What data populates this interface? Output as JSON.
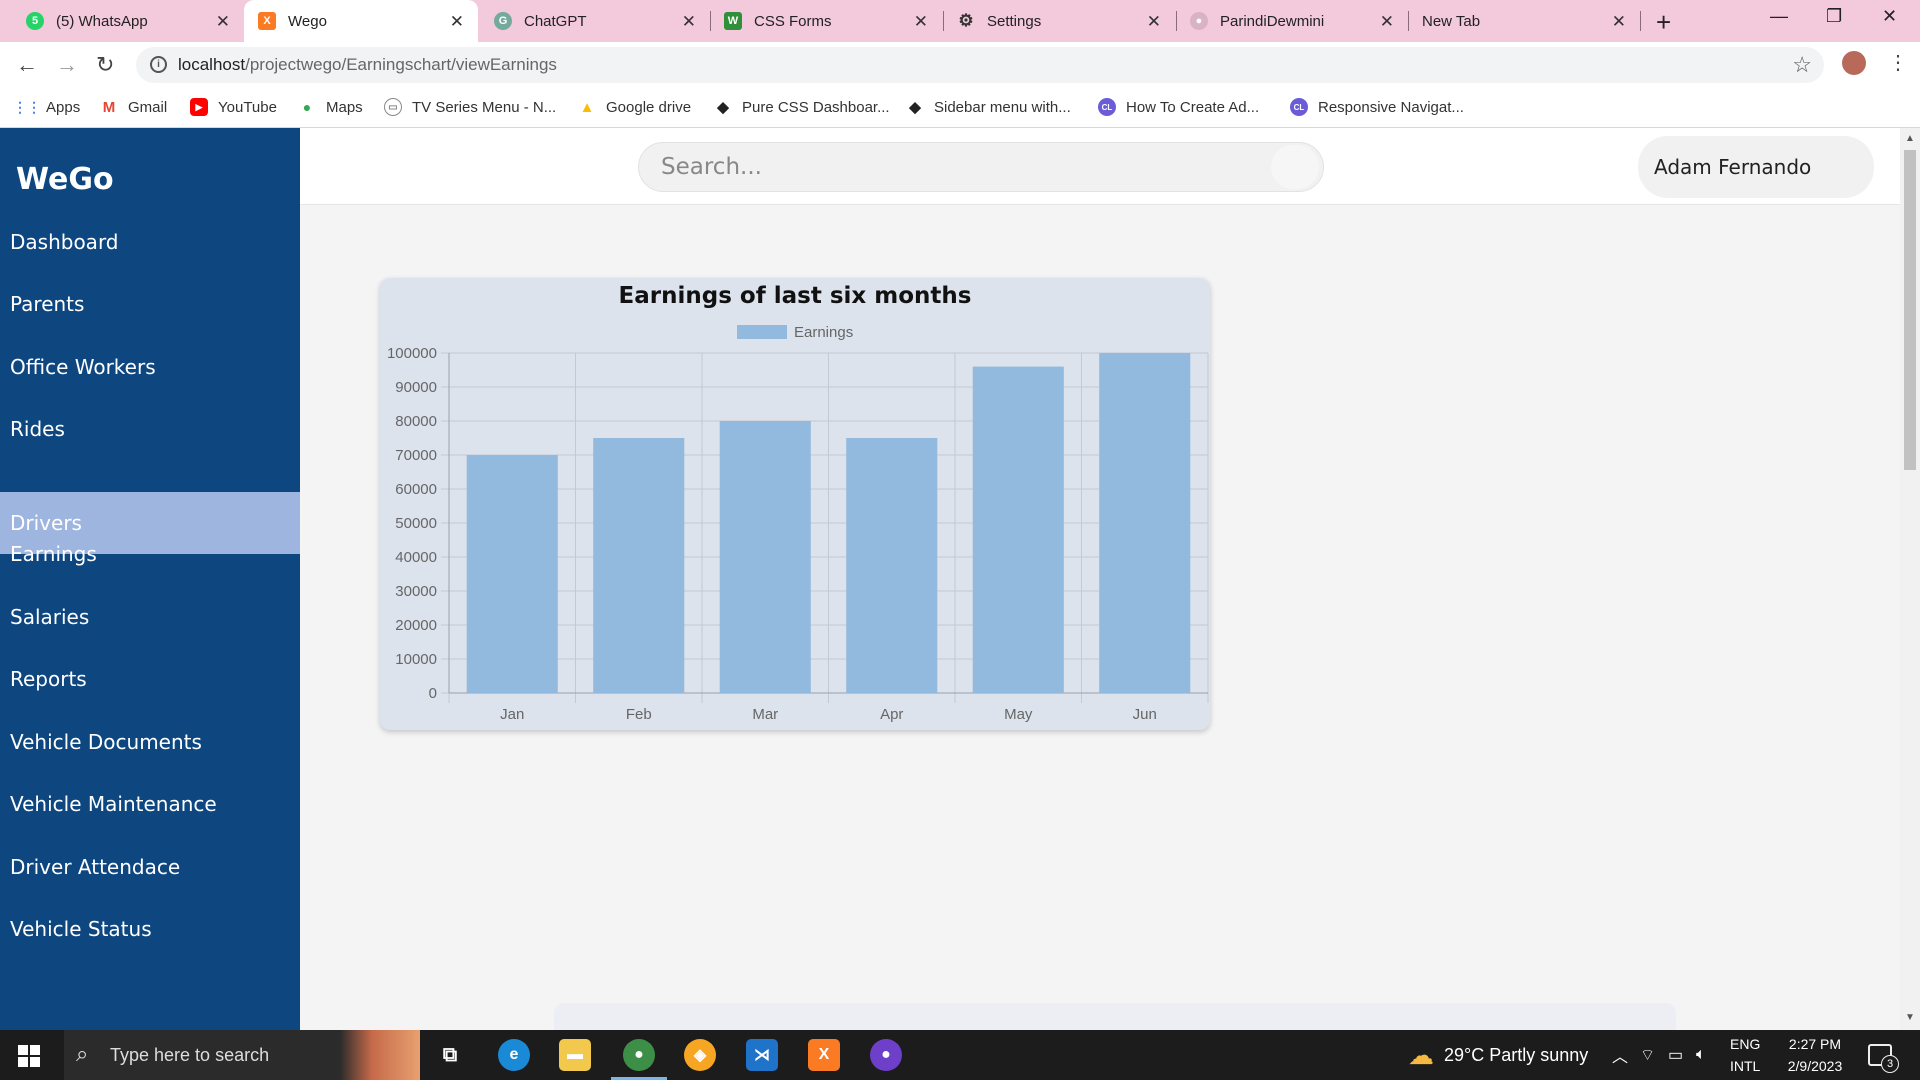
{
  "browser": {
    "tabs": [
      {
        "title": "(5) WhatsApp",
        "icon": "whatsapp-icon",
        "color": "#25d366",
        "badge": "5"
      },
      {
        "title": "Wego",
        "icon": "xampp-icon",
        "color": "#fb7a24",
        "badge": "X"
      },
      {
        "title": "ChatGPT",
        "icon": "chatgpt-icon",
        "color": "#74aa9c",
        "badge": "G"
      },
      {
        "title": "CSS Forms",
        "icon": "w3-icon",
        "color": "#2f8f3a",
        "badge": "W"
      },
      {
        "title": "Settings",
        "icon": "gear-icon",
        "color": "#333333",
        "badge": "⚙"
      },
      {
        "title": "ParindiDewmini",
        "icon": "github-icon",
        "color": "#d9b3c4",
        "badge": "●"
      },
      {
        "title": "New Tab",
        "icon": "",
        "color": "#f3c9dc",
        "badge": ""
      }
    ],
    "address": {
      "host": "localhost",
      "path": "/projectwego/Earningschart/viewEarnings"
    },
    "bookmarks": [
      {
        "label": "Apps",
        "icon": "apps-grid-icon",
        "color": "#4285f4",
        "glyph": "⋮⋮"
      },
      {
        "label": "Gmail",
        "icon": "gmail-icon",
        "color": "#ea4335",
        "glyph": "M"
      },
      {
        "label": "YouTube",
        "icon": "youtube-icon",
        "color": "#ff0000",
        "glyph": "▶"
      },
      {
        "label": "Maps",
        "icon": "maps-pin-icon",
        "color": "#34a853",
        "glyph": "●"
      },
      {
        "label": "TV Series Menu - N...",
        "icon": "tv-icon",
        "color": "#888888",
        "glyph": "▭"
      },
      {
        "label": "Google drive",
        "icon": "google-drive-icon",
        "color": "#fbbc04",
        "glyph": "▲"
      },
      {
        "label": "Pure CSS Dashboar...",
        "icon": "codepen-icon",
        "color": "#222222",
        "glyph": "◆"
      },
      {
        "label": "Sidebar menu with...",
        "icon": "codepen-icon",
        "color": "#222222",
        "glyph": "◆"
      },
      {
        "label": "How To Create Ad...",
        "icon": "cl-icon",
        "color": "#6b5bd6",
        "glyph": "CL"
      },
      {
        "label": "Responsive Navigat...",
        "icon": "cl-icon",
        "color": "#6b5bd6",
        "glyph": "CL"
      }
    ]
  },
  "app": {
    "logo": "WeGo",
    "menu": [
      {
        "label": "Dashboard",
        "active": false
      },
      {
        "label": "Parents",
        "active": false
      },
      {
        "label": "Office Workers",
        "active": false
      },
      {
        "label": "Rides",
        "active": false
      },
      {
        "label": "Drivers",
        "active": true
      },
      {
        "label": "Earnings",
        "active": false
      },
      {
        "label": "Salaries",
        "active": false
      },
      {
        "label": "Reports",
        "active": false
      },
      {
        "label": "Vehicle Documents",
        "active": false
      },
      {
        "label": "Vehicle Maintenance",
        "active": false
      },
      {
        "label": "Driver Attendace",
        "active": false
      },
      {
        "label": "Vehicle Status",
        "active": false
      }
    ],
    "search_placeholder": "Search...",
    "user_name": "Adam Fernando"
  },
  "chart_data": {
    "type": "bar",
    "title": "Earnings of last six months",
    "categories": [
      "Jan",
      "Feb",
      "Mar",
      "Apr",
      "May",
      "Jun"
    ],
    "series": [
      {
        "name": "Earnings",
        "values": [
          70000,
          75000,
          80000,
          75000,
          96000,
          100000
        ],
        "color": "#92badf"
      }
    ],
    "ylim": [
      0,
      100000
    ],
    "yticks": [
      "100000",
      "90000",
      "80000",
      "70000",
      "60000",
      "50000",
      "40000",
      "30000",
      "20000",
      "10000",
      "0"
    ],
    "legend": "top",
    "grid": true
  },
  "taskbar": {
    "search_placeholder": "Type here to search",
    "weather": "29°C  Partly sunny",
    "lang_top": "ENG",
    "lang_bottom": "INTL",
    "time": "2:27 PM",
    "date": "2/9/2023",
    "notifications": "3"
  }
}
